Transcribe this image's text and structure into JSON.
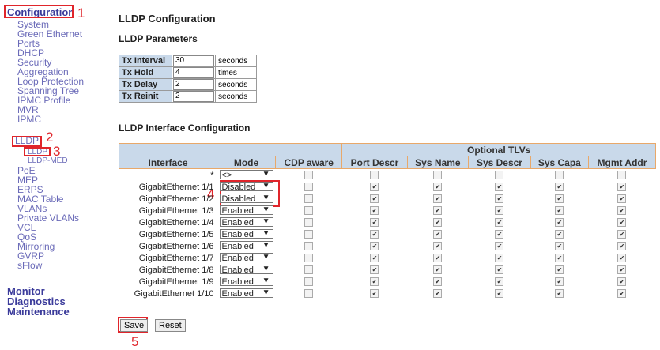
{
  "nav": {
    "configuration": "Configuration",
    "items": [
      "System",
      "Green Ethernet",
      "Ports",
      "DHCP",
      "Security",
      "Aggregation",
      "Loop Protection",
      "Spanning Tree",
      "IPMC Profile",
      "MVR",
      "IPMC",
      "LLDP",
      "PoE",
      "MEP",
      "ERPS",
      "MAC Table",
      "VLANs",
      "Private VLANs",
      "VCL",
      "QoS",
      "Mirroring",
      "GVRP",
      "sFlow"
    ],
    "lldp_sub": [
      "LLDP",
      "LLDP-MED"
    ],
    "monitor": "Monitor",
    "diagnostics": "Diagnostics",
    "maintenance": "Maintenance"
  },
  "annotations": [
    "1",
    "2",
    "3",
    "4",
    "5"
  ],
  "page": {
    "title": "LLDP Configuration",
    "params_title": "LLDP Parameters",
    "interface_title": "LLDP Interface Configuration"
  },
  "params": [
    {
      "label": "Tx Interval",
      "value": "30",
      "unit": "seconds"
    },
    {
      "label": "Tx Hold",
      "value": "4",
      "unit": "times"
    },
    {
      "label": "Tx Delay",
      "value": "2",
      "unit": "seconds"
    },
    {
      "label": "Tx Reinit",
      "value": "2",
      "unit": "seconds"
    }
  ],
  "table": {
    "optional_tlvs": "Optional TLVs",
    "headers": [
      "Interface",
      "Mode",
      "CDP aware",
      "Port Descr",
      "Sys Name",
      "Sys Descr",
      "Sys Capa",
      "Mgmt Addr"
    ],
    "wildcard": {
      "name": "*",
      "mode": "<>"
    },
    "rows": [
      {
        "name": "GigabitEthernet 1/1",
        "mode": "Disabled"
      },
      {
        "name": "GigabitEthernet 1/2",
        "mode": "Disabled"
      },
      {
        "name": "GigabitEthernet 1/3",
        "mode": "Enabled"
      },
      {
        "name": "GigabitEthernet 1/4",
        "mode": "Enabled"
      },
      {
        "name": "GigabitEthernet 1/5",
        "mode": "Enabled"
      },
      {
        "name": "GigabitEthernet 1/6",
        "mode": "Enabled"
      },
      {
        "name": "GigabitEthernet 1/7",
        "mode": "Enabled"
      },
      {
        "name": "GigabitEthernet 1/8",
        "mode": "Enabled"
      },
      {
        "name": "GigabitEthernet 1/9",
        "mode": "Enabled"
      },
      {
        "name": "GigabitEthernet 1/10",
        "mode": "Enabled"
      }
    ],
    "checked_mark": "✔"
  },
  "buttons": {
    "save": "Save",
    "reset": "Reset"
  }
}
